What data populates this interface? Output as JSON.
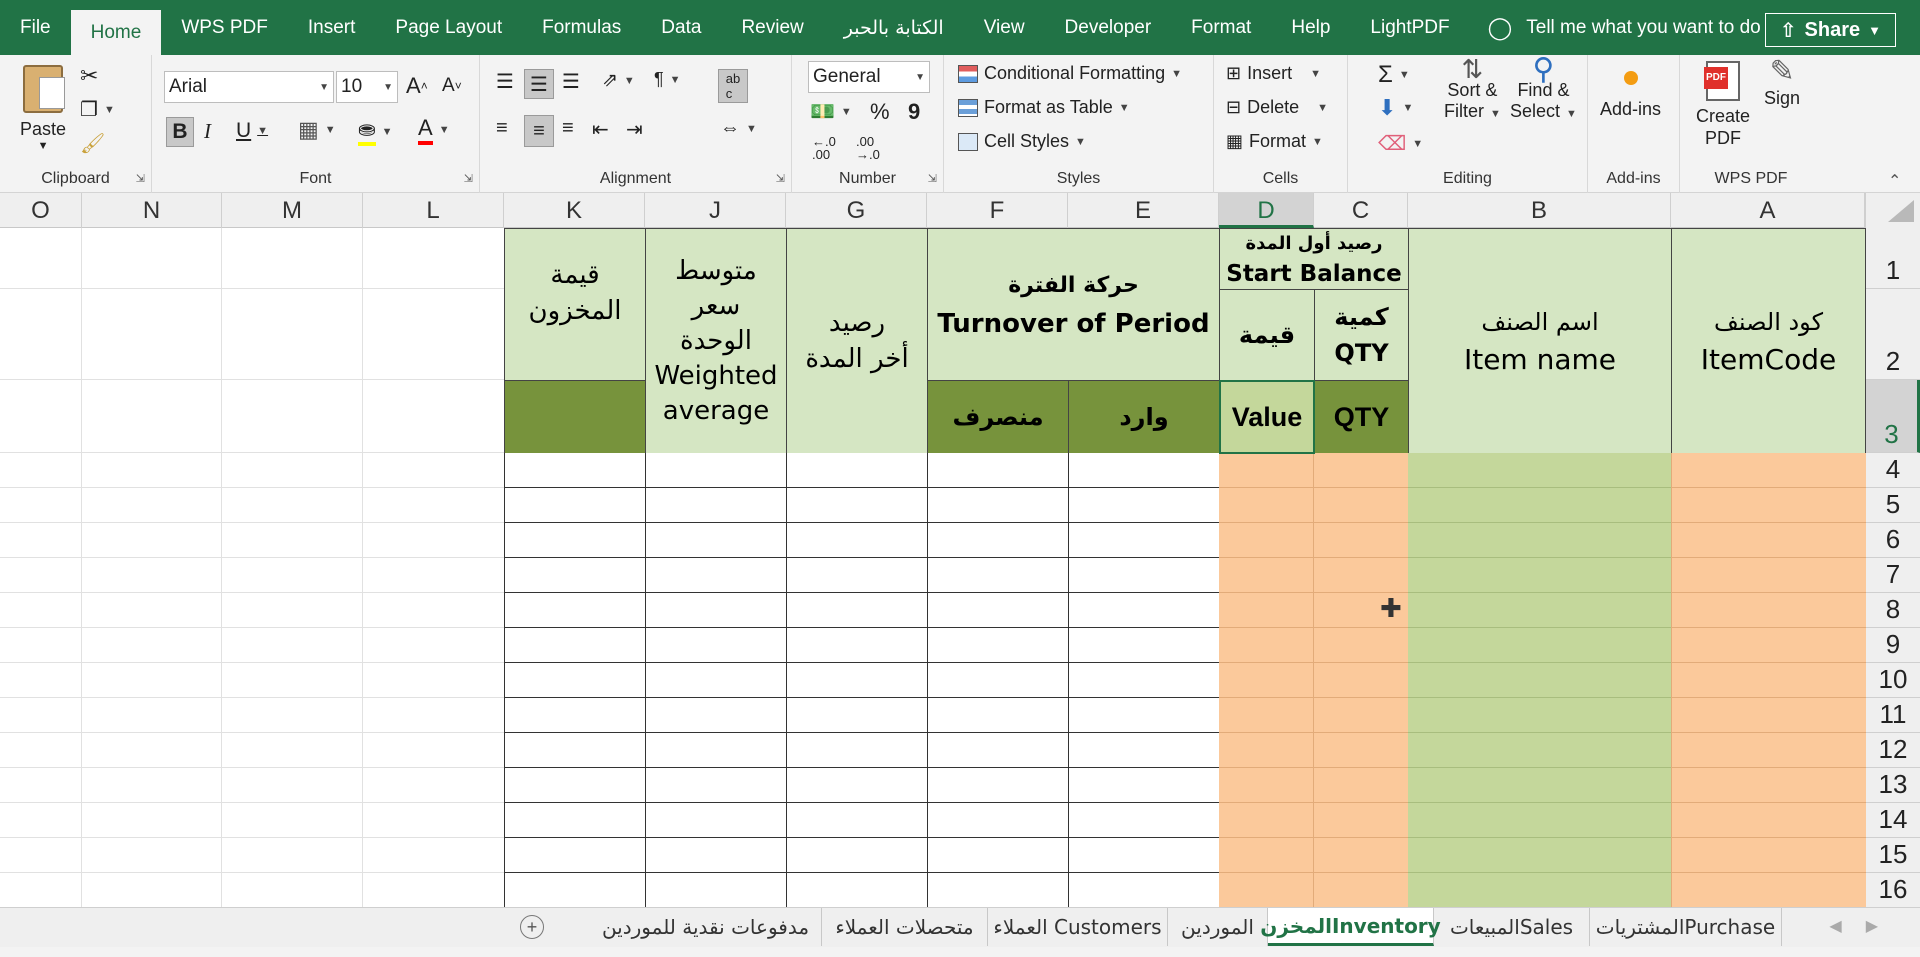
{
  "menu": {
    "items": [
      "File",
      "Home",
      "WPS PDF",
      "Insert",
      "Page Layout",
      "Formulas",
      "Data",
      "Review",
      "الكتابة بالحبر",
      "View",
      "Developer",
      "Format",
      "Help",
      "LightPDF"
    ],
    "active": "Home",
    "tell_me": "Tell me what you want to do",
    "share": "Share"
  },
  "ribbon": {
    "clipboard": {
      "label": "Clipboard",
      "paste": "Paste"
    },
    "font": {
      "label": "Font",
      "name": "Arial",
      "size": "10",
      "bold": "B",
      "italic": "I",
      "underline": "U",
      "grow": "A",
      "shrink": "A"
    },
    "alignment": {
      "label": "Alignment"
    },
    "number": {
      "label": "Number",
      "format": "General",
      "percent": "%",
      "comma": "9",
      "inc_decimal": "←.0 .00",
      "dec_decimal": ".00 →.0"
    },
    "styles": {
      "label": "Styles",
      "conditional": "Conditional Formatting",
      "table": "Format as Table",
      "cell_styles": "Cell Styles"
    },
    "cells": {
      "label": "Cells",
      "insert": "Insert",
      "delete": "Delete",
      "format": "Format"
    },
    "editing": {
      "label": "Editing",
      "sort_1": "Sort &",
      "sort_2": "Filter",
      "find_1": "Find &",
      "find_2": "Select"
    },
    "addins": {
      "label": "Add-ins",
      "button": "Add-ins"
    },
    "wps": {
      "label": "WPS PDF",
      "create_1": "Create",
      "create_2": "PDF",
      "sign": "Sign",
      "pdf_badge": "PDF"
    }
  },
  "columns": [
    "O",
    "N",
    "M",
    "L",
    "K",
    "J",
    "G",
    "F",
    "E",
    "D",
    "C",
    "B",
    "A"
  ],
  "rows": [
    "1",
    "2",
    "3",
    "4",
    "5",
    "6",
    "7",
    "8",
    "9",
    "10",
    "11",
    "12",
    "13",
    "14",
    "15",
    "16"
  ],
  "headers": {
    "item_code_ar": "كود الصنف",
    "item_code_en": "ItemCode",
    "item_name_ar": "اسم الصنف",
    "item_name_en": "Item name",
    "start_balance_ar": "رصيد أول المدة",
    "start_balance_en": "Start Balance",
    "qty_ar": "كمية",
    "qty_en": "QTY",
    "value_ar": "قيمة",
    "qty_row3": "QTY",
    "value_row3": "Value",
    "turnover_ar": "حركة الفترة",
    "turnover_en": "Turnover of Period",
    "incoming": "وارد",
    "outgoing": "منصرف",
    "end_balance_ar_1": "رصيد",
    "end_balance_ar_2": "أخر المدة",
    "wavg_ar_1": "متوسط",
    "wavg_ar_2": "سعر",
    "wavg_ar_3": "الوحدة",
    "wavg_en_1": "Weighted",
    "wavg_en_2": "average",
    "inventory_value_ar_1": "قيمة",
    "inventory_value_ar_2": "المخزون"
  },
  "sheets": [
    "المشترياتPurchase",
    "المبيعاتSales",
    "المخزنInventory",
    "الموردين",
    "العملاء Customers",
    "متحصلات العملاء",
    "مدفوعات نقدية للموردين"
  ],
  "active_sheet": "المخزنInventory",
  "add_sheet": "+",
  "colors": {
    "brand": "#217346",
    "orange": "#fbc99b",
    "green": "#c4d79b",
    "header_light": "#d5e6c3",
    "header_dark": "#77933c"
  }
}
